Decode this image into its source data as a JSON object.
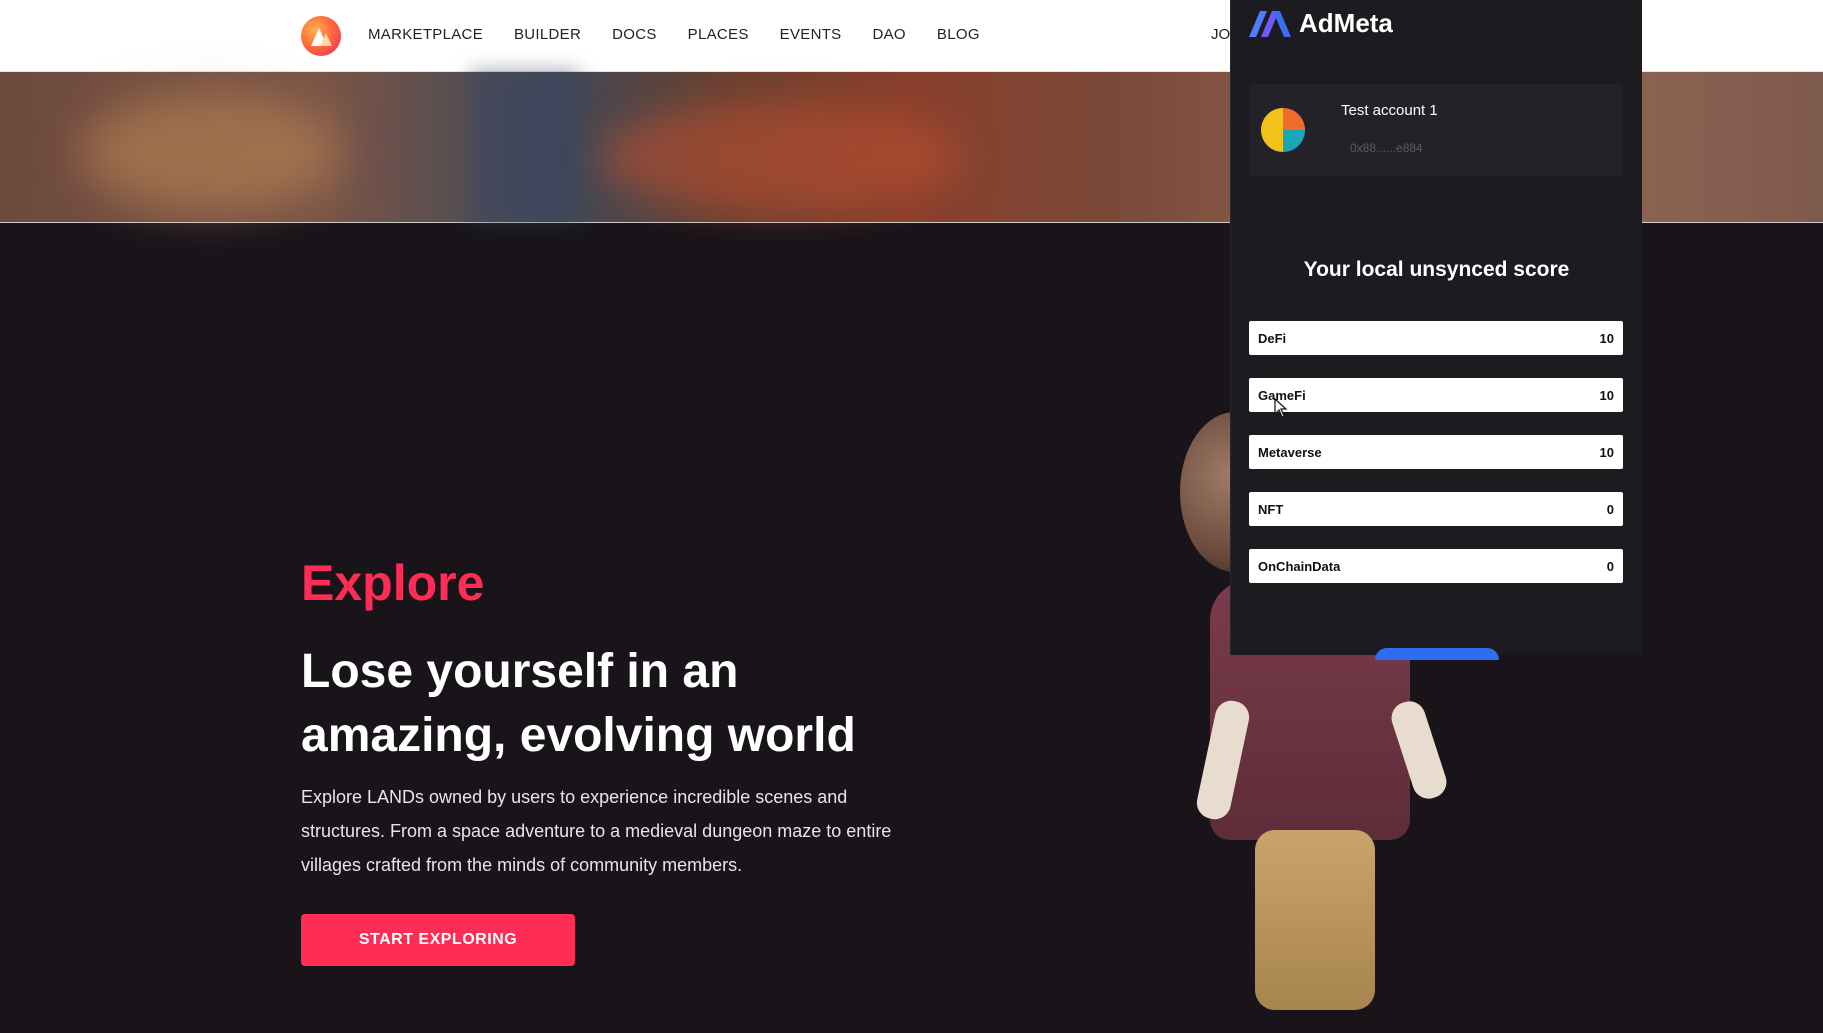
{
  "nav": {
    "items": [
      {
        "label": "MARKETPLACE"
      },
      {
        "label": "BUILDER"
      },
      {
        "label": "DOCS"
      },
      {
        "label": "PLACES"
      },
      {
        "label": "EVENTS"
      },
      {
        "label": "DAO"
      },
      {
        "label": "BLOG"
      }
    ],
    "cut_item": "JO"
  },
  "hero": {
    "section": "Explore",
    "headline": "Lose yourself in an amazing, evolving world",
    "body": "Explore LANDs owned by users to experience incredible scenes and structures. From a space adventure to a medieval dungeon maze to entire villages crafted from the minds of community members.",
    "cta_label": "START EXPLORING"
  },
  "extension": {
    "brand": "AdMeta",
    "account": {
      "name": "Test account 1",
      "address": "0x88......e884"
    },
    "score_title": "Your local unsynced score",
    "scores": [
      {
        "category": "DeFi",
        "value": "10"
      },
      {
        "category": "GameFi",
        "value": "10"
      },
      {
        "category": "Metaverse",
        "value": "10"
      },
      {
        "category": "NFT",
        "value": "0"
      },
      {
        "category": "OnChainData",
        "value": "0"
      }
    ]
  },
  "colors": {
    "accent": "#ff2d55",
    "page_bg": "#18141a",
    "panel_bg": "#1c1b20",
    "brand_blue": "#3b6cf6"
  },
  "icons": {
    "site_logo": "decentraland-logo-icon",
    "extension_logo": "admeta-logo-icon",
    "account_avatar": "account-avatar-icon",
    "cursor": "mouse-pointer-icon"
  }
}
